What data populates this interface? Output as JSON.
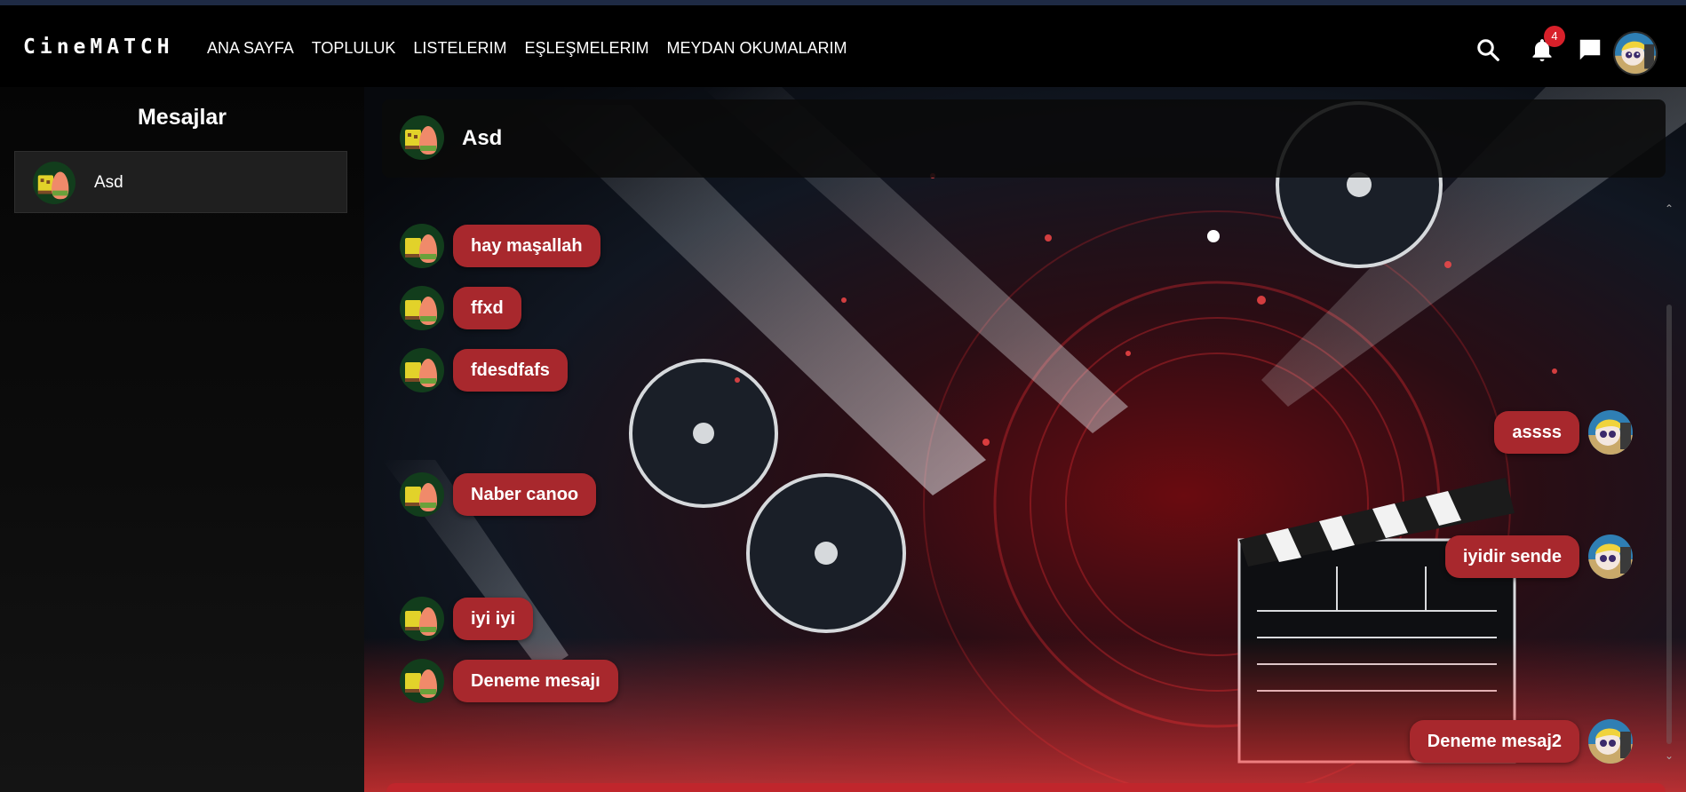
{
  "app": {
    "logo": "CineMATCH"
  },
  "nav": {
    "links": [
      "ANA SAYFA",
      "TOPLULUK",
      "LISTELERIM",
      "EŞLEŞMELERIM",
      "MEYDAN OKUMALARIM"
    ],
    "notification_count": "4",
    "icons": [
      "search-icon",
      "bell-icon",
      "chat-icon"
    ]
  },
  "sidebar": {
    "title": "Mesajlar",
    "conversations": [
      {
        "name": "Asd",
        "active": true
      }
    ]
  },
  "chat": {
    "header_name": "Asd",
    "messages": [
      {
        "side": "left",
        "text": "hay maşallah"
      },
      {
        "side": "left",
        "text": "ffxd"
      },
      {
        "side": "left",
        "text": "fdesdfafs"
      },
      {
        "side": "right",
        "text": "assss"
      },
      {
        "side": "left",
        "text": "Naber canoo"
      },
      {
        "side": "right",
        "text": "iyidir sende"
      },
      {
        "side": "left",
        "text": "iyi iyi"
      },
      {
        "side": "left",
        "text": "Deneme mesajı"
      },
      {
        "side": "right",
        "text": "Deneme mesaj2"
      }
    ]
  },
  "colors": {
    "bubble": "#a8282d",
    "badge": "#d8202a",
    "background": "#000000"
  }
}
